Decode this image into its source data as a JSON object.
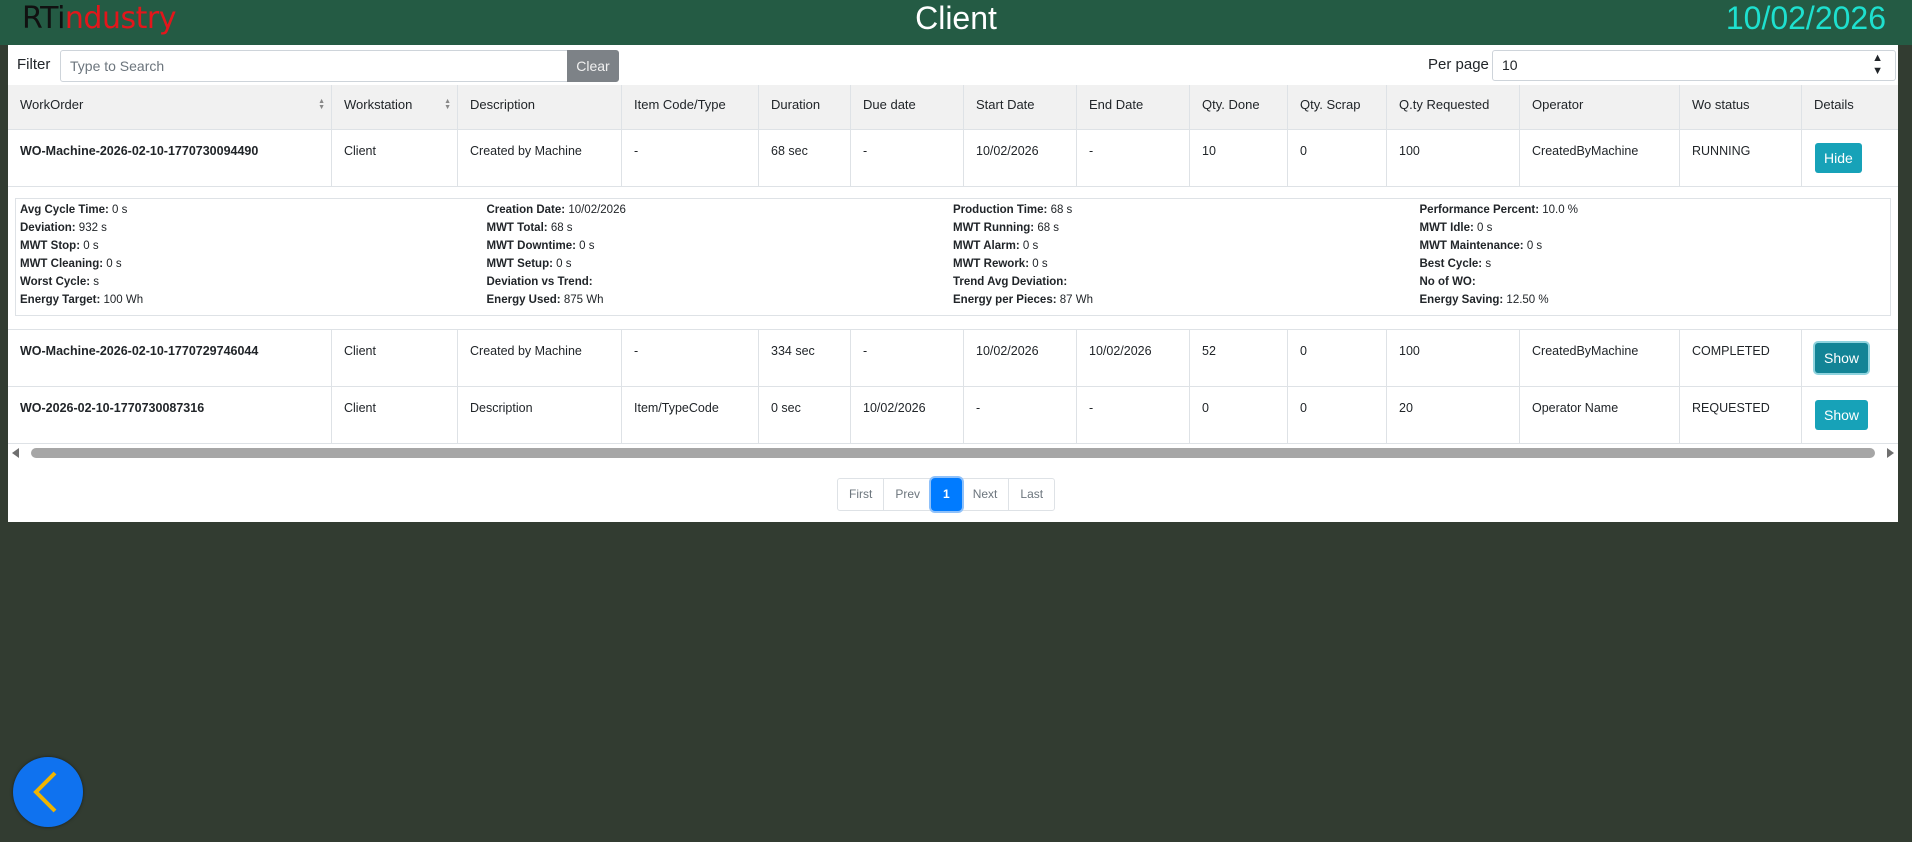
{
  "header": {
    "logo_rt": "RTi",
    "logo_industry": "ndustry",
    "title": "Client",
    "date": "10/02/2026"
  },
  "filter": {
    "label": "Filter",
    "placeholder": "Type to Search",
    "value": "",
    "clear_label": "Clear",
    "per_page_label": "Per page",
    "per_page_value": "10"
  },
  "table": {
    "columns": [
      "WorkOrder",
      "Workstation",
      "Description",
      "Item Code/Type",
      "Duration",
      "Due date",
      "Start Date",
      "End Date",
      "Qty. Done",
      "Qty. Scrap",
      "Q.ty Requested",
      "Operator",
      "Wo status",
      "Details"
    ],
    "rows": [
      {
        "workorder": "WO-Machine-2026-02-10-1770730094490",
        "workstation": "Client",
        "description": "Created by Machine",
        "item_code": "-",
        "duration": "68 sec",
        "due_date": "-",
        "start_date": "10/02/2026",
        "end_date": "-",
        "qty_done": "10",
        "qty_scrap": "0",
        "qty_requested": "100",
        "operator": "CreatedByMachine",
        "status": "RUNNING",
        "details_label": "Hide"
      },
      {
        "workorder": "WO-Machine-2026-02-10-1770729746044",
        "workstation": "Client",
        "description": "Created by Machine",
        "item_code": "-",
        "duration": "334 sec",
        "due_date": "-",
        "start_date": "10/02/2026",
        "end_date": "10/02/2026",
        "qty_done": "52",
        "qty_scrap": "0",
        "qty_requested": "100",
        "operator": "CreatedByMachine",
        "status": "COMPLETED",
        "details_label": "Show"
      },
      {
        "workorder": "WO-2026-02-10-1770730087316",
        "workstation": "Client",
        "description": "Description",
        "item_code": "Item/TypeCode",
        "duration": "0 sec",
        "due_date": "10/02/2026",
        "start_date": "-",
        "end_date": "-",
        "qty_done": "0",
        "qty_scrap": "0",
        "qty_requested": "20",
        "operator": "Operator Name",
        "status": "REQUESTED",
        "details_label": "Show"
      }
    ]
  },
  "details": {
    "columns": [
      [
        {
          "label": "Avg Cycle Time:",
          "value": "0 s"
        },
        {
          "label": "Deviation:",
          "value": "932 s"
        },
        {
          "label": "MWT Stop:",
          "value": "0 s"
        },
        {
          "label": "MWT Cleaning:",
          "value": "0 s"
        },
        {
          "label": "Worst Cycle:",
          "value": "s"
        },
        {
          "label": "Energy Target:",
          "value": "100 Wh"
        }
      ],
      [
        {
          "label": "Creation Date:",
          "value": "10/02/2026"
        },
        {
          "label": "MWT Total:",
          "value": "68 s"
        },
        {
          "label": "MWT Downtime:",
          "value": "0 s"
        },
        {
          "label": "MWT Setup:",
          "value": "0 s"
        },
        {
          "label": "Deviation vs Trend:",
          "value": ""
        },
        {
          "label": "Energy Used:",
          "value": "875 Wh"
        }
      ],
      [
        {
          "label": "Production Time:",
          "value": "68 s"
        },
        {
          "label": "MWT Running:",
          "value": "68 s"
        },
        {
          "label": "MWT Alarm:",
          "value": "0 s"
        },
        {
          "label": "MWT Rework:",
          "value": "0 s"
        },
        {
          "label": "Trend Avg Deviation:",
          "value": ""
        },
        {
          "label": "Energy per Pieces:",
          "value": "87 Wh"
        }
      ],
      [
        {
          "label": "Performance Percent:",
          "value": "10.0 %"
        },
        {
          "label": "MWT Idle:",
          "value": "0 s"
        },
        {
          "label": "MWT Maintenance:",
          "value": "0 s"
        },
        {
          "label": "Best Cycle:",
          "value": "s"
        },
        {
          "label": "No of WO:",
          "value": ""
        },
        {
          "label": "Energy Saving:",
          "value": "12.50 %"
        }
      ]
    ]
  },
  "pagination": {
    "first": "First",
    "prev": "Prev",
    "current": "1",
    "next": "Next",
    "last": "Last"
  },
  "colors": {
    "header_bg": "#245b44",
    "page_bg": "#323c31",
    "date_color": "#1ee0cf",
    "logo_red": "#e3161b",
    "button_teal": "#17a2b8",
    "page_active": "#007bff",
    "back_button": "#0f72ef",
    "back_arrow": "#f0b400"
  },
  "icons": {
    "back": "chevron-left-icon",
    "sort": "sort-icon",
    "select": "select-caret-icon"
  }
}
